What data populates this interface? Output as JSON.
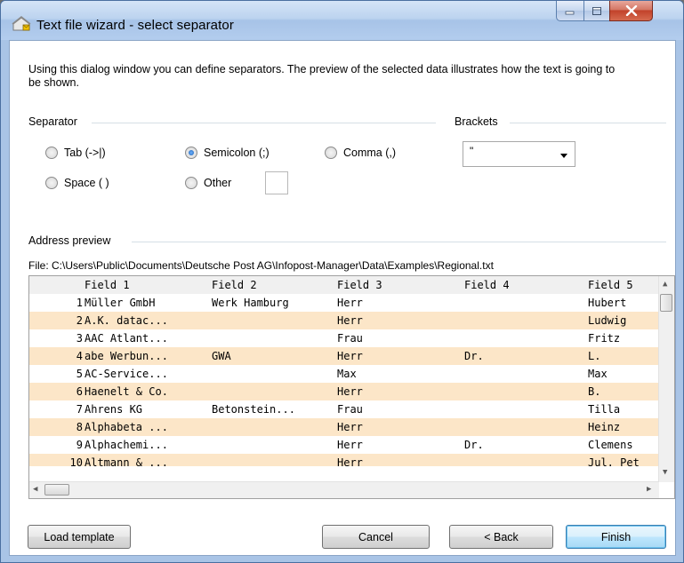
{
  "window": {
    "title": "Text file wizard - select separator"
  },
  "description": "Using this dialog window you can define separators. The preview of the selected data illustrates how the text is going to be shown.",
  "separator": {
    "label": "Separator",
    "options": [
      {
        "label": "Tab (->|)",
        "selected": false
      },
      {
        "label": "Semicolon (;)",
        "selected": true
      },
      {
        "label": "Comma (,)",
        "selected": false
      },
      {
        "label": "Space ( )",
        "selected": false
      },
      {
        "label": "Other",
        "selected": false
      }
    ],
    "other_value": ""
  },
  "brackets": {
    "label": "Brackets",
    "value": "\""
  },
  "preview": {
    "label": "Address preview",
    "file": "File: C:\\Users\\Public\\Documents\\Deutsche Post AG\\Infopost-Manager\\Data\\Examples\\Regional.txt",
    "columns": [
      "Field 1",
      "Field 2",
      "Field 3",
      "Field 4",
      "Field 5"
    ],
    "rows": [
      [
        "1",
        "Müller GmbH",
        "Werk Hamburg",
        "Herr",
        "",
        "Hubert"
      ],
      [
        "2",
        "A.K. datac...",
        "",
        "Herr",
        "",
        "Ludwig"
      ],
      [
        "3",
        "AAC Atlant...",
        "",
        "Frau",
        "",
        "Fritz"
      ],
      [
        "4",
        "abe Werbun...",
        "GWA",
        "Herr",
        "Dr.",
        "L."
      ],
      [
        "5",
        "AC-Service...",
        "",
        "Max",
        "",
        "Max"
      ],
      [
        "6",
        "Haenelt & Co.",
        "",
        "Herr",
        "",
        "B."
      ],
      [
        "7",
        "Ahrens KG",
        "Betonstein...",
        "Frau",
        "",
        "Tilla"
      ],
      [
        "8",
        "Alphabeta ...",
        "",
        "Herr",
        "",
        "Heinz"
      ],
      [
        "9",
        "Alphachemi...",
        "",
        "Herr",
        "Dr.",
        "Clemens"
      ],
      [
        "10",
        "Altmann & ...",
        "",
        "Herr",
        "",
        "Jul. Pet"
      ]
    ]
  },
  "buttons": {
    "load_template": "Load template",
    "cancel": "Cancel",
    "back": "< Back",
    "finish": "Finish"
  },
  "colors": {
    "alt_row": "#fce6c8",
    "titlebar": "#bcd3ef",
    "close": "#c2422a"
  }
}
